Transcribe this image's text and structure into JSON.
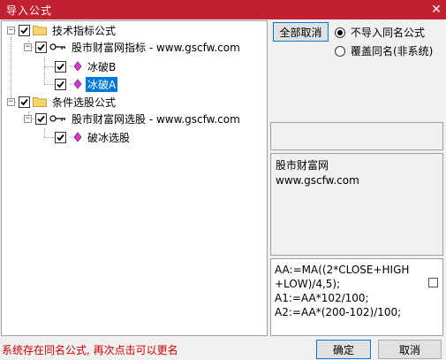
{
  "window": {
    "title": "导入公式",
    "close_glyph": "✕"
  },
  "tree": {
    "root1_label": "技术指标公式",
    "group1_label": "股市财富网指标 - www.gscfw.com",
    "item1_label": "冰破B",
    "item2_label": "冰破A",
    "root2_label": "条件选股公式",
    "group2_label": "股市财富网选股 - www.gscfw.com",
    "item3_label": "破冰选股"
  },
  "controls": {
    "cancel_all_label": "全部取消",
    "radio_no_import_label": "不导入同名公式",
    "radio_overwrite_label": "覆盖同名(非系统)",
    "radio_selected": "no_import"
  },
  "description": {
    "text": "股市财富网\nwww.gscfw.com"
  },
  "code": {
    "text": "AA:=MA((2*CLOSE+HIGH\n+LOW)/4,5);\nA1:=AA*102/100;\nA2:=AA*(200-102)/100;"
  },
  "status": {
    "message": "系统存在同名公式, 再次点击可以更名"
  },
  "buttons": {
    "ok_label": "确定",
    "cancel_label": "取消"
  },
  "colors": {
    "titlebar": "#c0202f",
    "selection": "#0078d7",
    "status_text": "#d00000"
  }
}
